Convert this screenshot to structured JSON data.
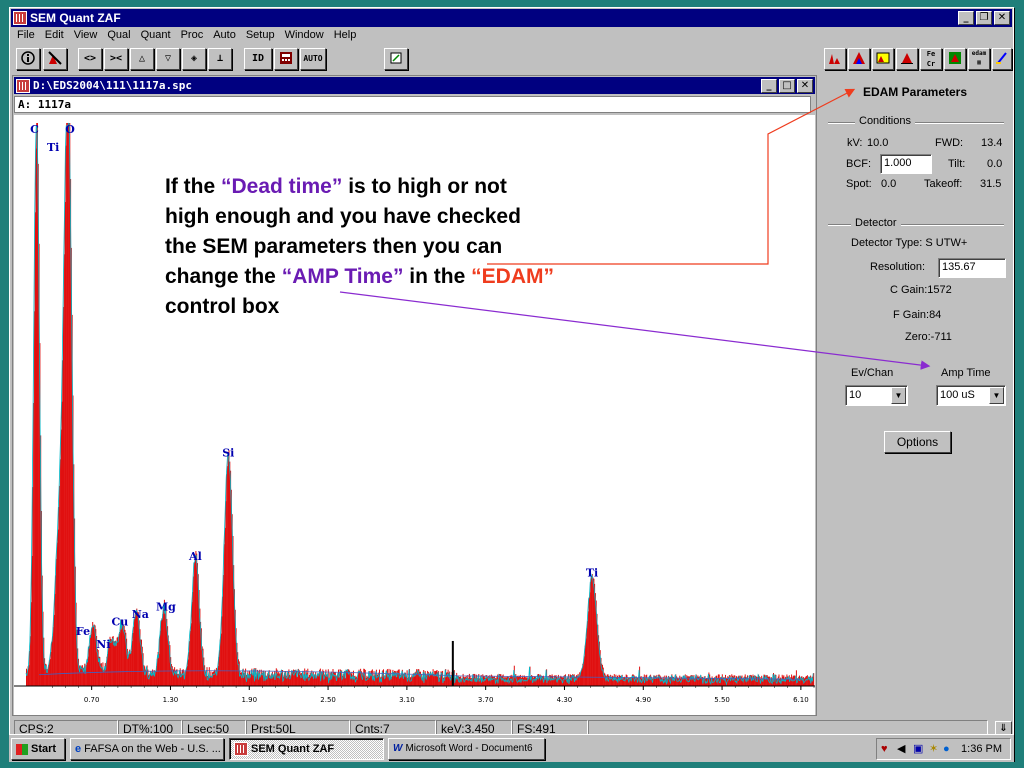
{
  "app": {
    "title": "SEM Quant ZAF",
    "menu": [
      "File",
      "Edit",
      "View",
      "Qual",
      "Quant",
      "Proc",
      "Auto",
      "Setup",
      "Window",
      "Help"
    ],
    "toolbar_text": {
      "id": "ID",
      "auto": "AUTO"
    }
  },
  "spectrum_window": {
    "title": "D:\\EDS2004\\111\\1117a.spc",
    "label_prefix": "A:",
    "label_value": "1117a"
  },
  "chart_data": {
    "type": "area",
    "xlabel": "",
    "ylabel": "",
    "xlim": [
      0.2,
      6.2
    ],
    "x_ticks": [
      "0.70",
      "1.30",
      "1.90",
      "2.50",
      "3.10",
      "3.70",
      "4.30",
      "4.90",
      "5.50",
      "6.10"
    ],
    "x_tick_values": [
      0.7,
      1.3,
      1.9,
      2.5,
      3.1,
      3.7,
      4.3,
      4.9,
      5.5,
      6.1
    ],
    "peaks": [
      {
        "label": "C",
        "x": 0.28,
        "height": 1.0,
        "width": 0.03
      },
      {
        "label": "O",
        "x": 0.52,
        "height": 1.0,
        "width": 0.04
      },
      {
        "label": "Ti",
        "x": 0.46,
        "height": 0.28,
        "width": 0.05
      },
      {
        "label": "Fe",
        "x": 0.71,
        "height": 0.08,
        "width": 0.04
      },
      {
        "label": "Ni",
        "x": 0.85,
        "height": 0.06,
        "width": 0.04
      },
      {
        "label": "Cu",
        "x": 0.93,
        "height": 0.09,
        "width": 0.04
      },
      {
        "label": "Na",
        "x": 1.04,
        "height": 0.11,
        "width": 0.04
      },
      {
        "label": "Mg",
        "x": 1.25,
        "height": 0.12,
        "width": 0.04
      },
      {
        "label": "Al",
        "x": 1.49,
        "height": 0.21,
        "width": 0.04
      },
      {
        "label": "Si",
        "x": 1.74,
        "height": 0.39,
        "width": 0.045
      },
      {
        "label": "Ti",
        "x": 4.51,
        "height": 0.18,
        "width": 0.05
      }
    ],
    "cursor_x": 3.45,
    "colors": {
      "fill": "#e01010",
      "outline": "#00b8c8",
      "label": "#0000b0"
    }
  },
  "edam": {
    "title": "EDAM Parameters",
    "conditions_label": "Conditions",
    "kv_label": "kV:",
    "kv_value": "10.0",
    "fwd_label": "FWD:",
    "fwd_value": "13.4",
    "bcf_label": "BCF:",
    "bcf_value": "1.000",
    "tilt_label": "Tilt:",
    "tilt_value": "0.0",
    "spot_label": "Spot:",
    "spot_value": "0.0",
    "takeoff_label": "Takeoff:",
    "takeoff_value": "31.5",
    "detector_label": "Detector",
    "detector_type": "Detector Type: S UTW+",
    "resolution_label": "Resolution:",
    "resolution_value": "135.67",
    "c_gain": "C Gain:1572",
    "f_gain": "F Gain:84",
    "zero": "Zero:-711",
    "ev_chan_label": "Ev/Chan",
    "ev_chan_value": "10",
    "amp_time_label": "Amp Time",
    "amp_time_value": "100 uS",
    "options_label": "Options"
  },
  "status": [
    "CPS:2",
    "DT%:100",
    "Lsec:50",
    "Prst:50L",
    "Cnts:7",
    "keV:3.450",
    "FS:491"
  ],
  "taskbar": {
    "start": "Start",
    "tasks": [
      "FAFSA on the Web - U.S. ...",
      "SEM Quant ZAF",
      "Microsoft Word - Document6"
    ],
    "clock": "1:36 PM"
  },
  "annotation": {
    "line1_a": "If the ",
    "line1_b": "“Dead time”",
    "line1_c": " is to high or not",
    "line2": "high enough and you have checked",
    "line3": "the SEM parameters then you can",
    "line4_a": "change the ",
    "line4_b": "“AMP Time”",
    "line4_c": " in the ",
    "line4_d": "“EDAM”",
    "line5": "control box",
    "colors": {
      "purple": "#6a1bb3",
      "orange": "#ef3c1e"
    }
  }
}
